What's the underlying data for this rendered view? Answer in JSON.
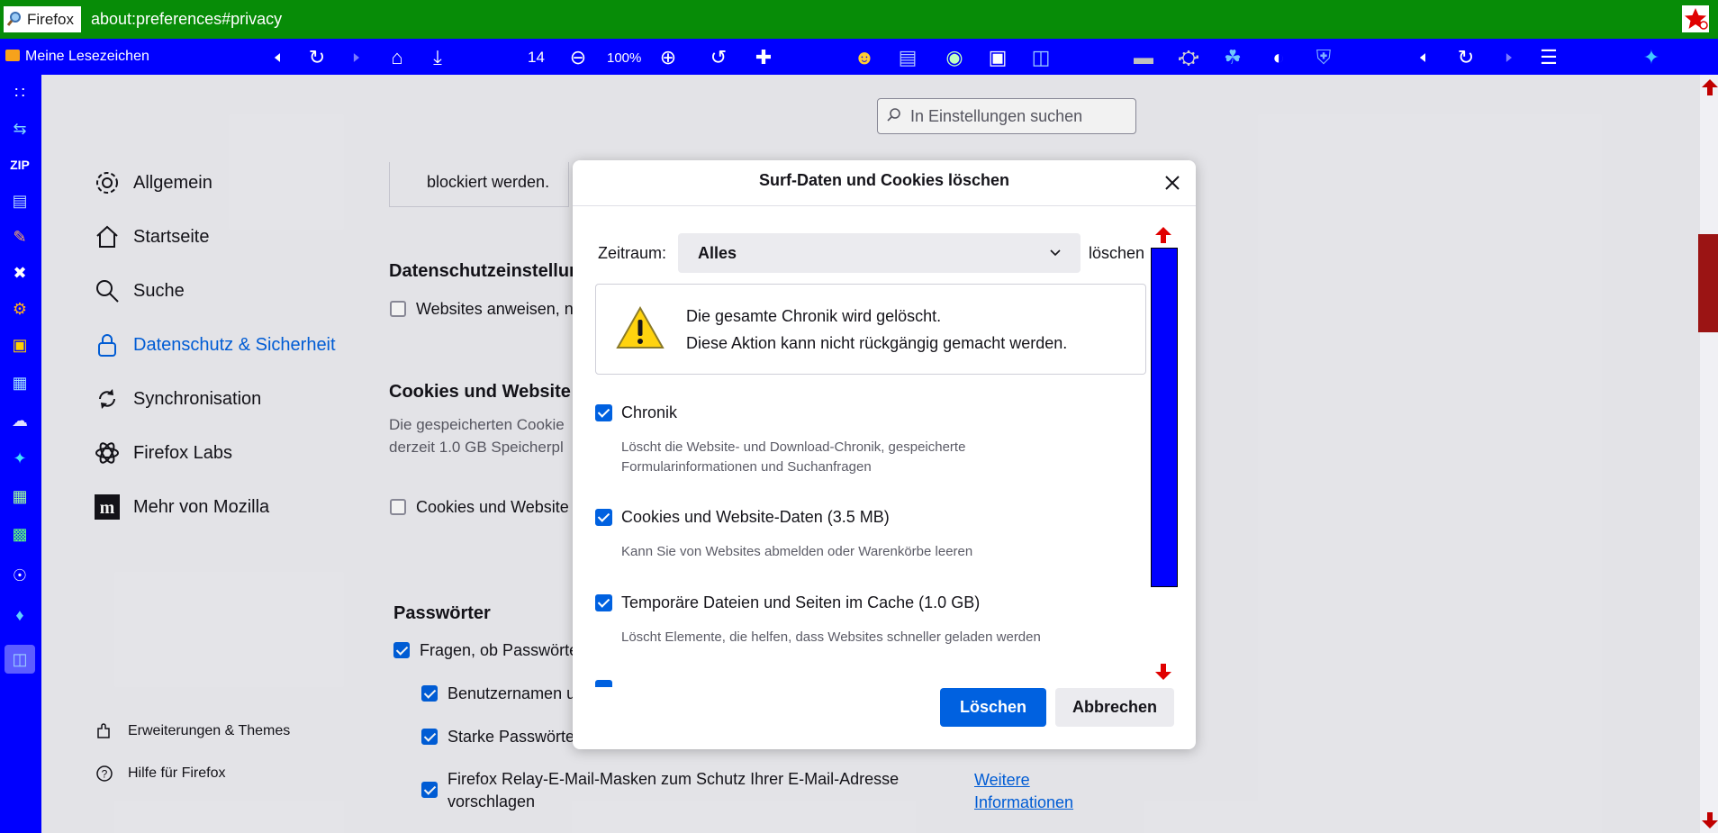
{
  "urlbar": {
    "brand": "Firefox",
    "url": "about:preferences#privacy",
    "bg_color": "#078c07"
  },
  "toolbar": {
    "bookmarks_label": "Meine Lesezeichen",
    "zoom_count": "14",
    "zoom_level": "100%",
    "bg_color": "#0000ff"
  },
  "search": {
    "placeholder": "In Einstellungen suchen"
  },
  "nav": {
    "items": [
      {
        "label": "Allgemein",
        "icon": "gear-icon"
      },
      {
        "label": "Startseite",
        "icon": "home-icon"
      },
      {
        "label": "Suche",
        "icon": "search-icon"
      },
      {
        "label": "Datenschutz & Sicherheit",
        "icon": "lock-icon",
        "selected": true
      },
      {
        "label": "Synchronisation",
        "icon": "sync-icon"
      },
      {
        "label": "Firefox Labs",
        "icon": "labs-icon"
      },
      {
        "label": "Mehr von Mozilla",
        "icon": "mozilla-icon"
      }
    ],
    "footer": [
      {
        "label": "Erweiterungen & Themes",
        "icon": "puzzle-icon"
      },
      {
        "label": "Hilfe für Firefox",
        "icon": "help-icon"
      }
    ]
  },
  "content": {
    "blocked_text": "blockiert werden.",
    "privacy_heading": "Datenschutzeinstellur",
    "websites_checkbox": "Websites anweisen, n",
    "cookies_heading": "Cookies und Website",
    "cookies_desc_1": "Die gespeicherten Cookie",
    "cookies_desc_2": "derzeit 1.0 GB Speicherpl",
    "cookies_checkbox": "Cookies und Website",
    "passwords_heading": "Passwörter",
    "pw_ask": "Fragen, ob Passwörte",
    "pw_user": "Benutzernamen u",
    "pw_strong": "Starke Passwörte",
    "pw_relay_1": "Firefox Relay-E-Mail-Masken zum Schutz Ihrer E-Mail-Adresse",
    "pw_relay_2": "vorschlagen",
    "more_info_1": "Weitere",
    "more_info_2": "Informationen"
  },
  "dialog": {
    "title": "Surf-Daten und Cookies löschen",
    "time_label": "Zeitraum:",
    "time_value": "Alles",
    "time_suffix": "löschen",
    "warning_line1": "Die gesamte Chronik wird gelöscht.",
    "warning_line2": "Diese Aktion kann nicht rückgängig gemacht werden.",
    "options": [
      {
        "label": "Chronik",
        "checked": true,
        "desc_1": "Löscht die Website- und Download-Chronik, gespeicherte",
        "desc_2": "Formularinformationen und Suchanfragen"
      },
      {
        "label": "Cookies und Website-Daten (3.5 MB)",
        "checked": true,
        "desc_1": "Kann Sie von Websites abmelden oder Warenkörbe leeren"
      },
      {
        "label": "Temporäre Dateien und Seiten im Cache (1.0 GB)",
        "checked": true,
        "desc_1": "Löscht Elemente, die helfen, dass Websites schneller geladen werden"
      }
    ],
    "delete_button": "Löschen",
    "cancel_button": "Abbrechen"
  },
  "colors": {
    "accent": "#0061e0",
    "scroll_thumb": "#0000ff",
    "arrow": "#e00000"
  }
}
